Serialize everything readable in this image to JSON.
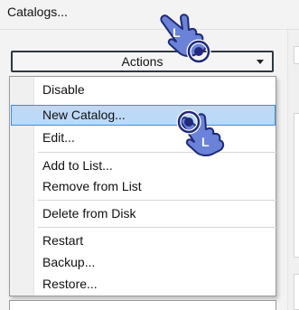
{
  "window": {
    "title": "Catalogs..."
  },
  "actions": {
    "label": "Actions"
  },
  "menu": {
    "items": [
      {
        "label": "Disable"
      },
      {
        "label": "New Catalog..."
      },
      {
        "label": "Edit..."
      },
      {
        "label": "Add to List..."
      },
      {
        "label": "Remove from List"
      },
      {
        "label": "Delete from Disk"
      },
      {
        "label": "Restart"
      },
      {
        "label": "Backup..."
      },
      {
        "label": "Restore..."
      }
    ]
  },
  "cursors": [
    {
      "icon": "pointing-hand-cursor-icon",
      "letter": "L"
    },
    {
      "icon": "pointing-hand-cursor-icon",
      "letter": "L"
    }
  ],
  "colors": {
    "highlight": "#bcd9f7",
    "highlight_border": "#3d8ee0",
    "cursor_fill": "#6a82d8"
  }
}
